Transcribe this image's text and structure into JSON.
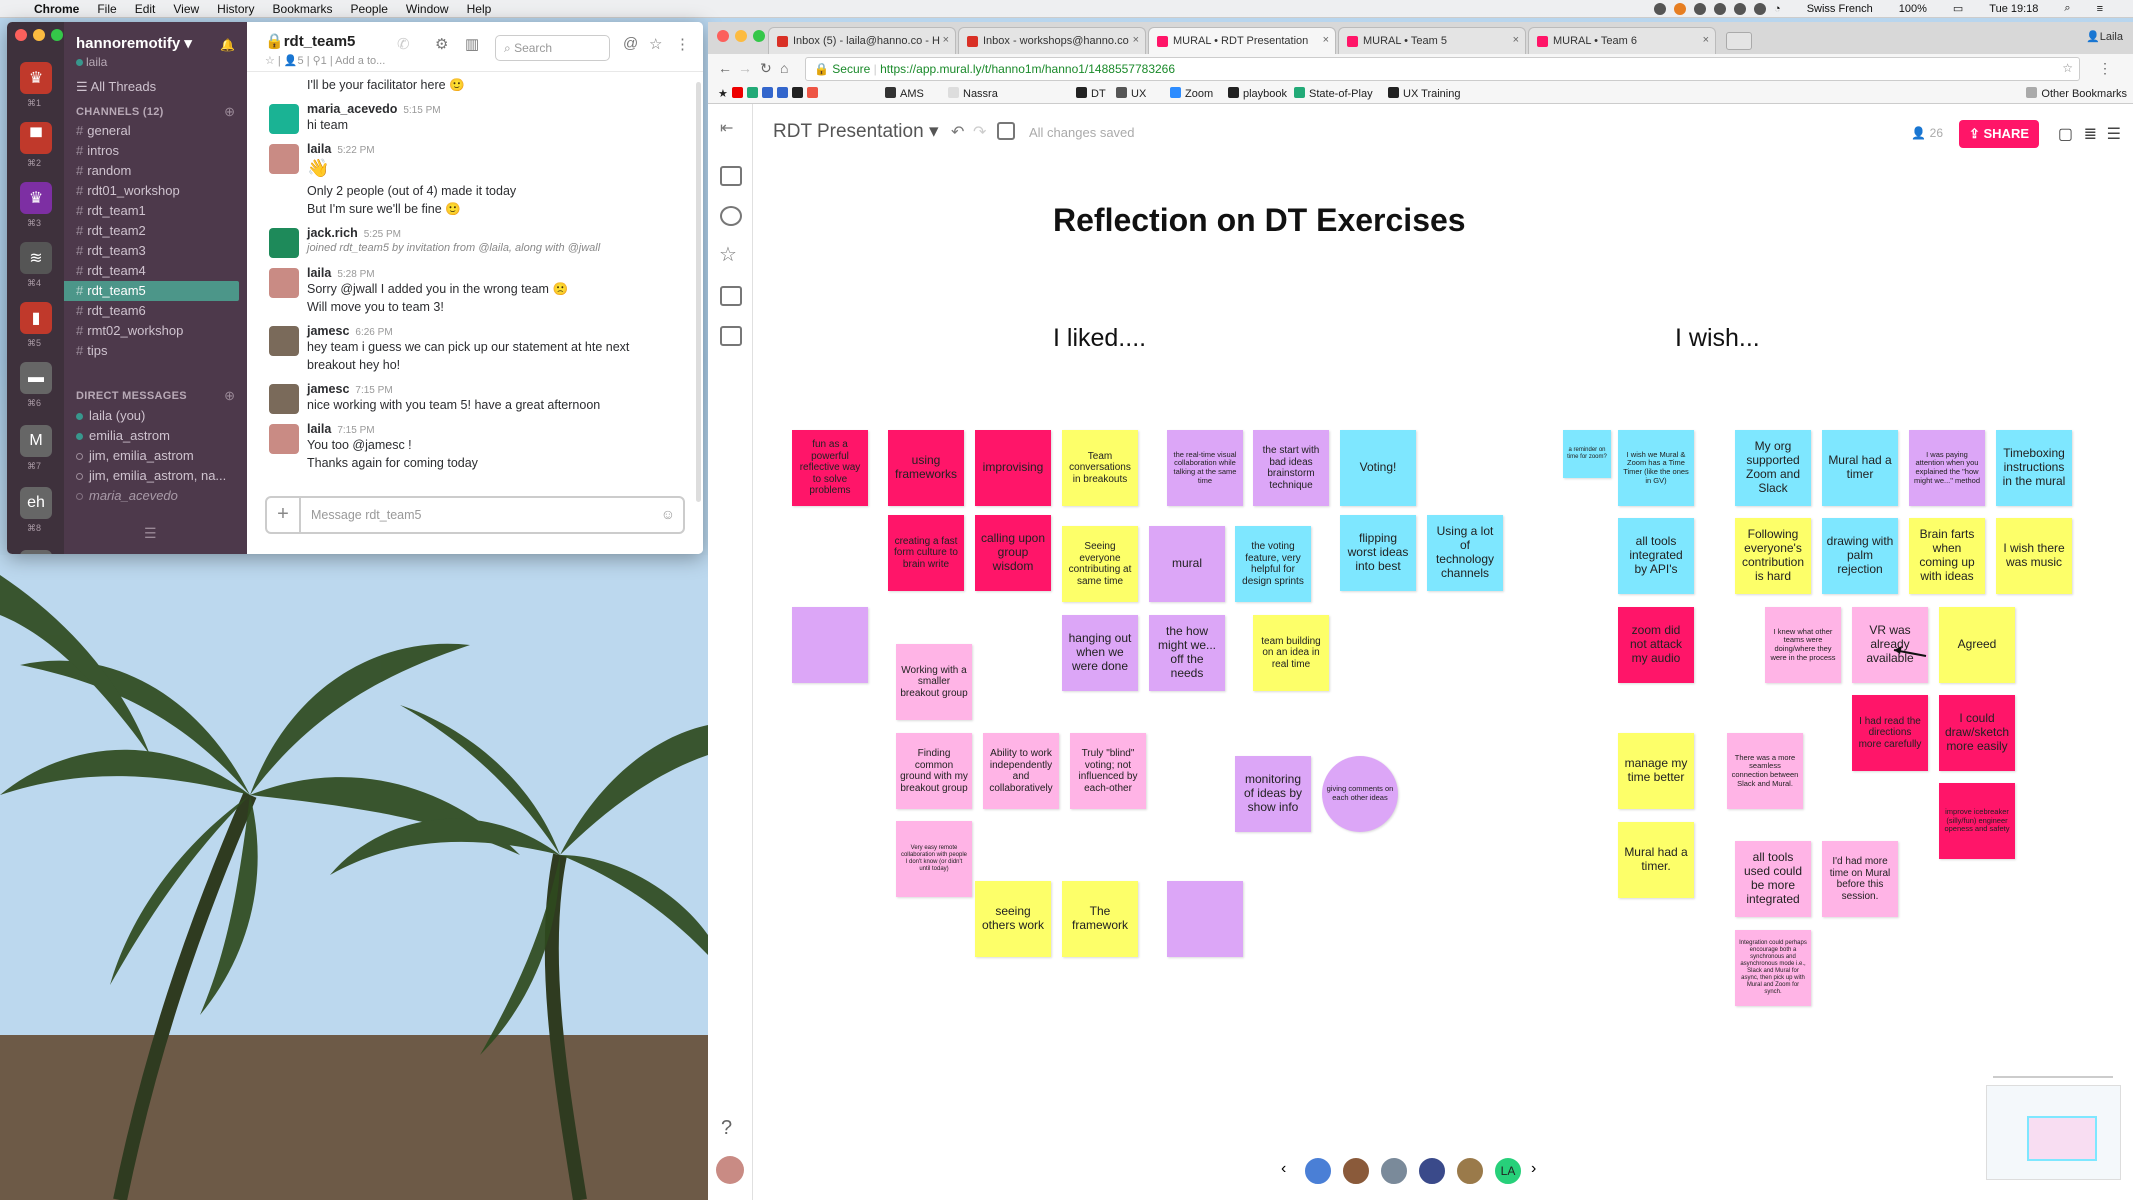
{
  "menubar": {
    "app": "Chrome",
    "items": [
      "File",
      "Edit",
      "View",
      "History",
      "Bookmarks",
      "People",
      "Window",
      "Help"
    ],
    "input_source": "Swiss French",
    "battery": "100%",
    "clock": "Tue 19:18"
  },
  "slack": {
    "workspaces": [
      {
        "num": "⌘1",
        "color": "#c0392b",
        "glyph": "♛"
      },
      {
        "num": "⌘2",
        "color": "#c0392b",
        "glyph": "▀"
      },
      {
        "num": "⌘3",
        "color": "#7d2fa3",
        "glyph": "♛"
      },
      {
        "num": "⌘4",
        "color": "#555",
        "glyph": "≋"
      },
      {
        "num": "⌘5",
        "color": "#c0392b",
        "glyph": "▮"
      },
      {
        "num": "⌘6",
        "color": "#666",
        "glyph": "▬"
      },
      {
        "num": "⌘7",
        "color": "#666",
        "glyph": "M"
      },
      {
        "num": "⌘8",
        "color": "#666",
        "glyph": "eh"
      },
      {
        "num": "",
        "color": "#666",
        "glyph": "P"
      }
    ],
    "team": "hannoremotify",
    "user": "laila",
    "all_threads": "All Threads",
    "channels_header": "CHANNELS",
    "channels_count": "(12)",
    "channels": [
      "general",
      "intros",
      "random",
      "rdt01_workshop",
      "rdt_team1",
      "rdt_team2",
      "rdt_team3",
      "rdt_team4",
      "rdt_team5",
      "rdt_team6",
      "rmt02_workshop",
      "tips"
    ],
    "active_channel_index": 8,
    "dm_header": "DIRECT MESSAGES",
    "dms": [
      "laila (you)",
      "emilia_astrom",
      "jim, emilia_astrom",
      "jim, emilia_astrom, na...",
      "maria_acevedo"
    ],
    "channel_title": "rdt_team5",
    "channel_meta": "☆ | 👤5 | ⚲1 | Add a to...",
    "search_placeholder": "Search",
    "compose_placeholder": "Message rdt_team5",
    "messages": [
      {
        "type": "cont",
        "text": "I'll be your facilitator here 🙂"
      },
      {
        "type": "head",
        "author": "maria_acevedo",
        "time": "5:15 PM",
        "text": "hi team",
        "avatar": "#1ab394"
      },
      {
        "type": "head",
        "author": "laila",
        "time": "5:22 PM",
        "text": "👋",
        "avatar": "#c98b84"
      },
      {
        "type": "cont",
        "text": "Only 2 people (out of 4) made it today"
      },
      {
        "type": "cont",
        "text": "But I'm sure we'll be fine 🙂"
      },
      {
        "type": "head",
        "author": "jack.rich",
        "time": "5:25 PM",
        "text": "joined rdt_team5 by invitation from @laila, along with @jwall",
        "avatar": "#1e8a5a"
      },
      {
        "type": "head",
        "author": "laila",
        "time": "5:28 PM",
        "text": "Sorry @jwall I added you in the wrong team 🙁",
        "avatar": "#c98b84"
      },
      {
        "type": "cont",
        "text": "Will move you to team 3!"
      },
      {
        "type": "head",
        "author": "jamesc",
        "time": "6:26 PM",
        "text": "hey team i guess we can pick up our statement at hte next",
        "text2": "breakout hey ho!",
        "avatar": "#7a6a5a"
      },
      {
        "type": "head",
        "author": "jamesc",
        "time": "7:15 PM",
        "text": "nice working with you team 5!  have a great afternoon",
        "avatar": "#7a6a5a"
      },
      {
        "type": "head",
        "author": "laila",
        "time": "7:15 PM",
        "text": "You too @jamesc !",
        "avatar": "#c98b84"
      },
      {
        "type": "cont",
        "text": "Thanks again for coming today"
      }
    ]
  },
  "chrome": {
    "tabs": [
      {
        "label": "Inbox (5) - laila@hanno.co - H",
        "color": "#d93025",
        "active": false
      },
      {
        "label": "Inbox - workshops@hanno.co",
        "color": "#d93025",
        "active": false
      },
      {
        "label": "MURAL • RDT Presentation",
        "color": "#ff1568",
        "active": true
      },
      {
        "label": "MURAL • Team 5",
        "color": "#ff1568",
        "active": false
      },
      {
        "label": "MURAL • Team 6",
        "color": "#ff1568",
        "active": false
      }
    ],
    "profile": "Laila",
    "secure_label": "Secure",
    "url": "https://app.mural.ly/t/hanno1m/hanno1/1488557783266",
    "bookmarks": [
      "AMS",
      "Nassra",
      "DT",
      "UX",
      "Zoom",
      "playbook",
      "State-of-Play",
      "UX Training"
    ],
    "other_bookmarks": "Other Bookmarks"
  },
  "mural": {
    "name": "RDT Presentation",
    "saved": "All changes saved",
    "user_count": "26",
    "share_label": "SHARE",
    "title": "Reflection on DT Exercises",
    "liked_header": "I liked....",
    "wish_header": "I wish...",
    "help": "?",
    "participant_initials": "LA",
    "notes": [
      {
        "t": "fun as a powerful reflective way to solve problems",
        "c": "pink",
        "s": "sm"
      },
      {
        "t": "using frameworks",
        "c": "pink",
        "s": ""
      },
      {
        "t": "improvising",
        "c": "pink",
        "s": ""
      },
      {
        "t": "Team conversations in breakouts",
        "c": "yellow",
        "s": "sm"
      },
      {
        "t": "the real-time visual collaboration while talking at the same time",
        "c": "lav",
        "s": "xs"
      },
      {
        "t": "the start with bad ideas brainstorm technique",
        "c": "lav",
        "s": "sm"
      },
      {
        "t": "Voting!",
        "c": "cyan",
        "s": ""
      },
      {
        "t": "creating a fast form culture to brain write",
        "c": "pink",
        "s": "sm"
      },
      {
        "t": "calling upon group wisdom",
        "c": "pink",
        "s": ""
      },
      {
        "t": "Seeing everyone contributing at same time",
        "c": "yellow",
        "s": "sm"
      },
      {
        "t": "mural",
        "c": "lav",
        "s": ""
      },
      {
        "t": "the voting feature, very helpful for design sprints",
        "c": "cyan",
        "s": "sm"
      },
      {
        "t": "flipping worst ideas into best",
        "c": "cyan",
        "s": ""
      },
      {
        "t": "Using a lot of technology channels",
        "c": "cyan",
        "s": ""
      },
      {
        "t": "",
        "c": "lav",
        "s": ""
      },
      {
        "t": "Working with a smaller breakout group",
        "c": "lpink",
        "s": "sm"
      },
      {
        "t": "hanging out when we were done",
        "c": "lav",
        "s": ""
      },
      {
        "t": "the how might we... off the needs",
        "c": "lav",
        "s": ""
      },
      {
        "t": "team building on an idea in real time",
        "c": "yellow",
        "s": "sm"
      },
      {
        "t": "Finding common ground with my breakout group",
        "c": "lpink",
        "s": "sm"
      },
      {
        "t": "Ability to work independently and collaboratively",
        "c": "lpink",
        "s": "sm"
      },
      {
        "t": "Truly \"blind\" voting; not influenced by each-other",
        "c": "lpink",
        "s": "sm"
      },
      {
        "t": "monitoring of ideas by show info",
        "c": "lav",
        "s": ""
      },
      {
        "t": "giving comments on each other ideas",
        "c": "lav",
        "s": "xs"
      },
      {
        "t": "Very easy remote collaboration with people I don't know (or didn't until today)",
        "c": "lpink",
        "s": "xxs"
      },
      {
        "t": "seeing others work",
        "c": "yellow",
        "s": ""
      },
      {
        "t": "The framework",
        "c": "yellow",
        "s": ""
      },
      {
        "t": "",
        "c": "lav",
        "s": ""
      },
      {
        "t": "a reminder on time for zoom?",
        "c": "cyan",
        "s": "xxs"
      },
      {
        "t": "I wish we Mural & Zoom has a Time Timer (like the ones in GV)",
        "c": "cyan",
        "s": "xs"
      },
      {
        "t": "My org supported Zoom and Slack",
        "c": "cyan",
        "s": ""
      },
      {
        "t": "Mural had a timer",
        "c": "cyan",
        "s": ""
      },
      {
        "t": "I was paying attention when you explained the \"how might we...\" method",
        "c": "lav",
        "s": "xs"
      },
      {
        "t": "Timeboxing instructions in the mural",
        "c": "cyan",
        "s": ""
      },
      {
        "t": "all tools integrated by API's",
        "c": "cyan",
        "s": ""
      },
      {
        "t": "Following everyone's contribution is hard",
        "c": "yellow",
        "s": ""
      },
      {
        "t": "drawing with palm rejection",
        "c": "cyan",
        "s": ""
      },
      {
        "t": "Brain farts when coming up with ideas",
        "c": "yellow",
        "s": ""
      },
      {
        "t": "I wish there was music",
        "c": "yellow",
        "s": ""
      },
      {
        "t": "zoom did not attack my audio",
        "c": "pink",
        "s": ""
      },
      {
        "t": "I knew what other teams were doing/where they were in the process",
        "c": "lpink",
        "s": "xs"
      },
      {
        "t": "VR was already available",
        "c": "lpink",
        "s": ""
      },
      {
        "t": "Agreed",
        "c": "yellow",
        "s": ""
      },
      {
        "t": "I had read the directions more carefully",
        "c": "pink",
        "s": "sm"
      },
      {
        "t": "I could draw/sketch more easily",
        "c": "pink",
        "s": ""
      },
      {
        "t": "manage my time better",
        "c": "yellow",
        "s": ""
      },
      {
        "t": "There was a more seamless connection between Slack and Mural.",
        "c": "lpink",
        "s": "xs"
      },
      {
        "t": "improve icebreaker (silly/fun) engineer openess and safety",
        "c": "pink",
        "s": "xs"
      },
      {
        "t": "Mural had a timer.",
        "c": "yellow",
        "s": ""
      },
      {
        "t": "all tools used could be more integrated",
        "c": "lpink",
        "s": ""
      },
      {
        "t": "I'd had more time on Mural before this session.",
        "c": "lpink",
        "s": "sm"
      },
      {
        "t": "Integration could perhaps encourage both a synchronous and asynchronous mode i.e., Slack and Mural for async, then pick up with Mural and Zoom for synch.",
        "c": "lpink",
        "s": "xxs"
      }
    ]
  },
  "colors": {
    "accent": "#ff1568",
    "slack_sidebar": "#4d394b",
    "slack_active": "#4c9689"
  }
}
